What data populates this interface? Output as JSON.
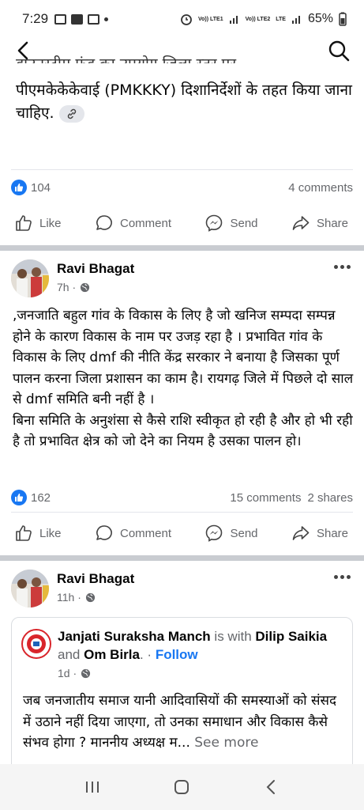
{
  "status_bar": {
    "time": "7:29",
    "network1": "Vo)) LTE1",
    "network2": "Vo)) LTE2",
    "lte": "LTE",
    "battery": "65%"
  },
  "post1": {
    "cut_line": "डाउनस्ट्रीम फंड का उपयोग जिला स्तर पर",
    "tail_text": "पीएमकेकेकेवाई (PMKKKY) दिशानिर्देशों के तहत किया जाना चाहिए.",
    "likes": "104",
    "comments": "4 comments"
  },
  "actions": {
    "like": "Like",
    "comment": "Comment",
    "send": "Send",
    "share": "Share"
  },
  "post2": {
    "author": "Ravi Bhagat",
    "time": "7h ·",
    "body": ",जनजाति बहुल गांव के विकास के लिए है जो खनिज सम्पदा सम्पन्न होने के कारण विकास के नाम पर उजड़ रहा है । प्रभावित गांव के विकास के लिए dmf की नीति  केंद्र सरकार ने बनाया है जिसका पूर्ण पालन करना जिला प्रशासन का काम है। रायगढ़ जिले में पिछले दो साल से dmf समिति बनी नहीं है ।\n बिना समिति के अनुशंसा से कैसे राशि स्वीकृत हो रही है और हो भी रही है तो प्रभावित क्षेत्र को जो देने का नियम है उसका पालन हो।",
    "likes": "162",
    "comments": "15 comments",
    "shares": "2 shares"
  },
  "post3": {
    "author": "Ravi Bhagat",
    "time": "11h ·",
    "shared": {
      "page": "Janjati Suraksha Manch",
      "is_with": "is with",
      "person1": "Dilip Saikia",
      "and": "and",
      "person2": "Om Birla",
      "follow_sep": ". ·",
      "follow": "Follow",
      "time": "1d ·",
      "body": "जब जनजातीय समाज यानी आदिवासियों की समस्याओं को संसद में उठाने नहीं दिया जाएगा, तो उनका समाधान और विकास कैसे संभव होगा ? माननीय अध्यक्ष म...",
      "see_more": "See more"
    }
  },
  "colors": {
    "accent": "#1877f2",
    "muted": "#65676b",
    "separator": "#c9ccd1"
  },
  "icons": [
    "back-arrow-icon",
    "search-icon",
    "like-icon",
    "comment-icon",
    "messenger-icon",
    "share-icon",
    "globe-icon",
    "more-icon",
    "link-icon"
  ]
}
